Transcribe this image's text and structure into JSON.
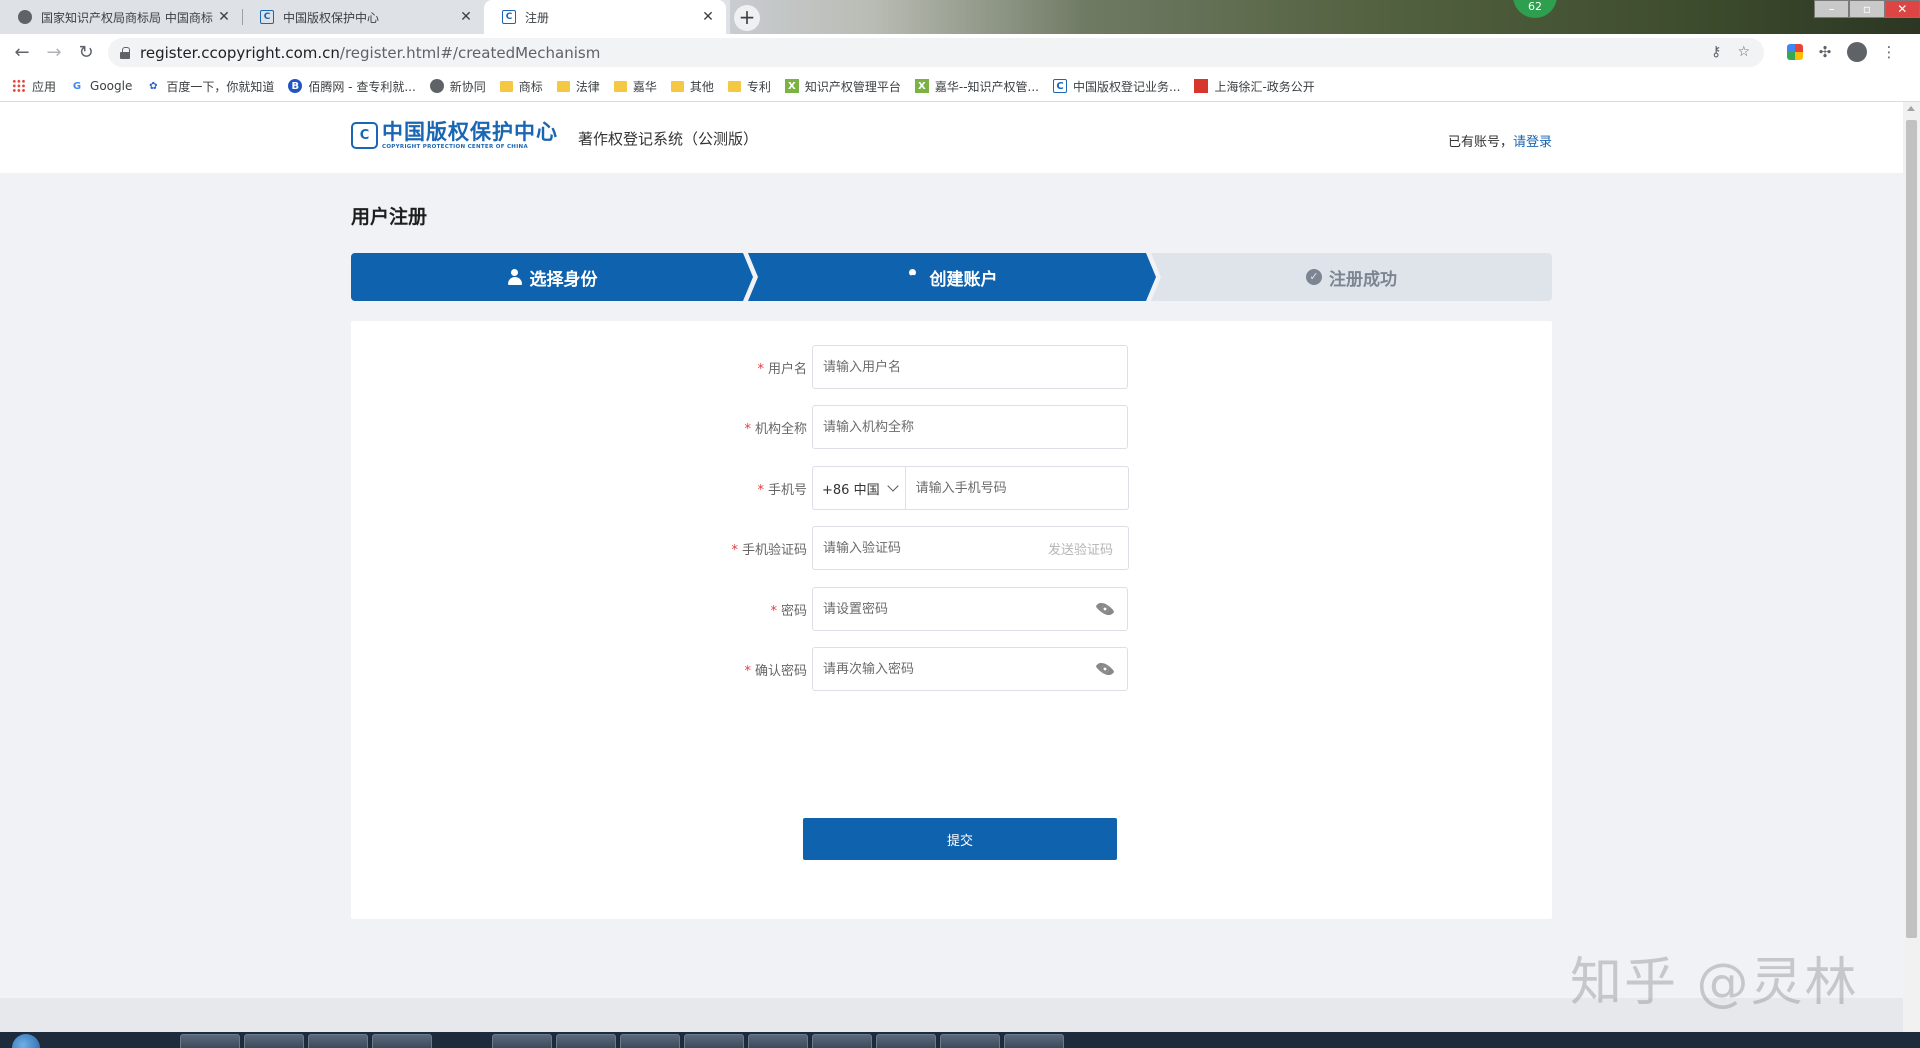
{
  "browser": {
    "tabs": [
      {
        "title": "国家知识产权局商标局 中国商标",
        "icon": "globe-icon"
      },
      {
        "title": "中国版权保护中心",
        "icon": "cpcc-icon"
      },
      {
        "title": "注册",
        "icon": "cpcc-icon",
        "active": true
      }
    ],
    "new_tab": "+",
    "badge": "62",
    "url_host": "register.ccopyright.com.cn",
    "url_path": "/register.html#/createdMechanism",
    "bookmarks": [
      {
        "label": "应用",
        "icon": "apps-grid-icon"
      },
      {
        "label": "Google",
        "icon": "google-icon"
      },
      {
        "label": "百度一下，你就知道",
        "icon": "baidu-paw-icon"
      },
      {
        "label": "佰腾网 - 查专利就...",
        "icon": "baiten-icon"
      },
      {
        "label": "新协同",
        "icon": "globe-icon"
      },
      {
        "label": "商标",
        "icon": "folder-icon"
      },
      {
        "label": "法律",
        "icon": "folder-icon"
      },
      {
        "label": "嘉华",
        "icon": "folder-icon"
      },
      {
        "label": "其他",
        "icon": "folder-icon"
      },
      {
        "label": "专利",
        "icon": "folder-icon"
      },
      {
        "label": "知识产权管理平台",
        "icon": "ix-icon"
      },
      {
        "label": "嘉华--知识产权管...",
        "icon": "ix-icon"
      },
      {
        "label": "中国版权登记业务...",
        "icon": "cpcc-icon"
      },
      {
        "label": "上海徐汇-政务公开",
        "icon": "red-seal-icon"
      }
    ]
  },
  "header": {
    "logo_mark": "C",
    "logo_cn": "中国版权保护中心",
    "logo_en": "COPYRIGHT PROTECTION CENTER OF CHINA",
    "system_name": "著作权登记系统（公测版）",
    "login_prefix": "已有账号，",
    "login_link": "请登录"
  },
  "page_title": "用户注册",
  "steps": [
    {
      "label": "选择身份",
      "icon": "person-icon",
      "state": "done"
    },
    {
      "label": "创建账户",
      "icon": "add-user-icon",
      "state": "active"
    },
    {
      "label": "注册成功",
      "icon": "check-circle-icon",
      "state": "pending"
    }
  ],
  "form": {
    "username": {
      "label": "用户名",
      "placeholder": "请输入用户名",
      "required": "*"
    },
    "org_name": {
      "label": "机构全称",
      "placeholder": "请输入机构全称",
      "required": "*"
    },
    "phone": {
      "label": "手机号",
      "country_code": "+86 中国",
      "placeholder": "请输入手机号码",
      "required": "*"
    },
    "sms_code": {
      "label": "手机验证码",
      "placeholder": "请输入验证码",
      "send_label": "发送验证码",
      "required": "*"
    },
    "password": {
      "label": "密码",
      "placeholder": "请设置密码",
      "required": "*"
    },
    "confirm_password": {
      "label": "确认密码",
      "placeholder": "请再次输入密码",
      "required": "*"
    },
    "submit_label": "提交"
  },
  "watermark": "知乎 @灵林",
  "colors": {
    "primary": "#0f62ae",
    "step_pending_bg": "#dfe4ea",
    "required": "#e4393c",
    "page_bg": "#f0f2f5"
  }
}
